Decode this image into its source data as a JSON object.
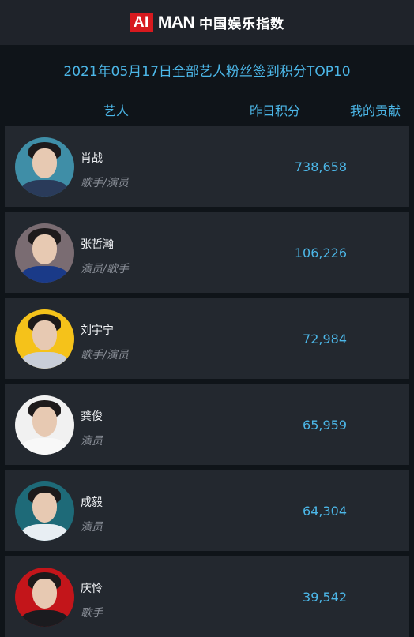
{
  "brand": {
    "ai": "AI",
    "man": "MAN",
    "sub": "中国娱乐指数",
    "ai_color": "#d7191e"
  },
  "headline": "2021年05月17日全部艺人粉丝签到积分TOP10",
  "columns": {
    "artist": "艺人",
    "score": "昨日积分",
    "contribution": "我的贡献"
  },
  "accent": "#4cb7e8",
  "artists": [
    {
      "name": "肖战",
      "role": "歌手/演员",
      "score": "738,658",
      "avatar_bg": "#3f8ea7",
      "clothes": "#2a3b5a"
    },
    {
      "name": "张哲瀚",
      "role": "演员/歌手",
      "score": "106,226",
      "avatar_bg": "#7a6c72",
      "clothes": "#1a3a88"
    },
    {
      "name": "刘宇宁",
      "role": "歌手/演员",
      "score": "72,984",
      "avatar_bg": "#f5c21a",
      "clothes": "#c9ced8"
    },
    {
      "name": "龚俊",
      "role": "演员",
      "score": "65,959",
      "avatar_bg": "#f1f1f1",
      "clothes": "#f8f8f8"
    },
    {
      "name": "成毅",
      "role": "演员",
      "score": "64,304",
      "avatar_bg": "#1e6a78",
      "clothes": "#e8eef3"
    },
    {
      "name": "庆怜",
      "role": "歌手",
      "score": "39,542",
      "avatar_bg": "#c3151a",
      "clothes": "#1b1b1f"
    }
  ]
}
